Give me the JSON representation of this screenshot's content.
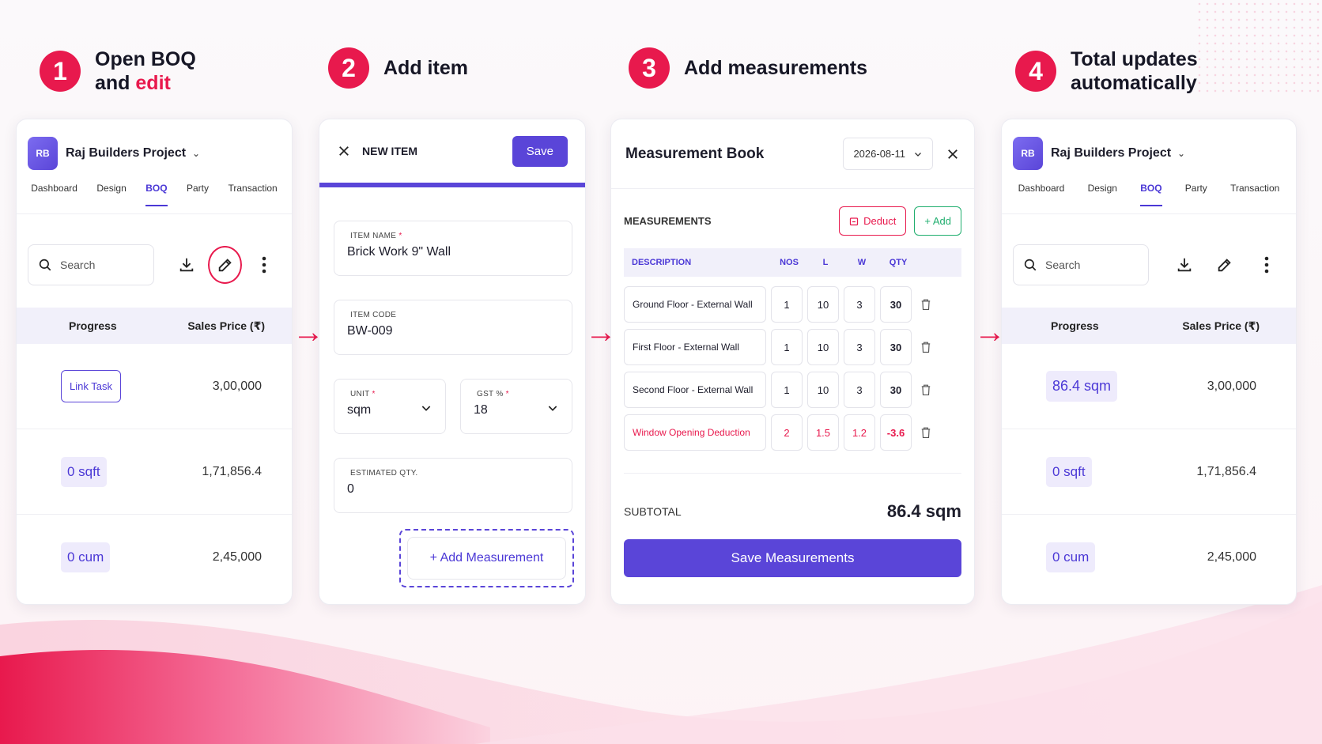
{
  "steps": [
    {
      "num": "1",
      "line1": "Open BOQ",
      "line2_plain": "and ",
      "line2_accent": "edit"
    },
    {
      "num": "2",
      "title": "Add item"
    },
    {
      "num": "3",
      "title": "Add measurements"
    },
    {
      "num": "4",
      "line1": "Total updates",
      "line2": "automatically"
    }
  ],
  "colors": {
    "accent": "#e8194d",
    "primary": "#5a45d8",
    "success": "#1fae6e"
  },
  "boq_before": {
    "avatar": "RB",
    "project": "Raj Builders Project",
    "tabs": [
      "Dashboard",
      "Design",
      "BOQ",
      "Party",
      "Transaction"
    ],
    "active_tab": "BOQ",
    "search_placeholder": "Search",
    "col_progress": "Progress",
    "col_price": "Sales Price (₹)",
    "rows": [
      {
        "progress": "Link Task",
        "price": "3,00,000"
      },
      {
        "progress": "0 sqft",
        "price": "1,71,856.4"
      },
      {
        "progress": "0 cum",
        "price": "2,45,000"
      }
    ]
  },
  "new_item": {
    "title": "NEW ITEM",
    "save": "Save",
    "item_name_label": "ITEM NAME",
    "item_name": "Brick Work 9\" Wall",
    "item_code_label": "ITEM CODE",
    "item_code": "BW-009",
    "unit_label": "UNIT",
    "unit": "sqm",
    "gst_label": "GST %",
    "gst": "18",
    "qty_label": "ESTIMATED QTY.",
    "qty": "0",
    "add_measurement": "+ Add Measurement",
    "required_mark": "*"
  },
  "measurement_book": {
    "title": "Measurement Book",
    "date": "2026-08-11",
    "section": "MEASUREMENTS",
    "deduct": "Deduct",
    "add": "+ Add",
    "headers": {
      "desc": "DESCRIPTION",
      "nos": "NOS",
      "l": "L",
      "w": "W",
      "qty": "QTY"
    },
    "rows": [
      {
        "desc": "Ground Floor - External Wall",
        "nos": "1",
        "l": "10",
        "w": "3",
        "qty": "30"
      },
      {
        "desc": "First Floor - External Wall",
        "nos": "1",
        "l": "10",
        "w": "3",
        "qty": "30"
      },
      {
        "desc": "Second Floor - External Wall",
        "nos": "1",
        "l": "10",
        "w": "3",
        "qty": "30"
      },
      {
        "desc": "Window Opening Deduction",
        "nos": "2",
        "l": "1.5",
        "w": "1.2",
        "qty": "-3.6"
      }
    ],
    "subtotal_label": "SUBTOTAL",
    "subtotal": "86.4 sqm",
    "save_button": "Save Measurements"
  },
  "boq_after": {
    "avatar": "RB",
    "project": "Raj Builders Project",
    "tabs": [
      "Dashboard",
      "Design",
      "BOQ",
      "Party",
      "Transaction"
    ],
    "active_tab": "BOQ",
    "search_placeholder": "Search",
    "col_progress": "Progress",
    "col_price": "Sales Price (₹)",
    "rows": [
      {
        "progress": "86.4 sqm",
        "price": "3,00,000"
      },
      {
        "progress": "0 sqft",
        "price": "1,71,856.4"
      },
      {
        "progress": "0 cum",
        "price": "2,45,000"
      }
    ]
  }
}
